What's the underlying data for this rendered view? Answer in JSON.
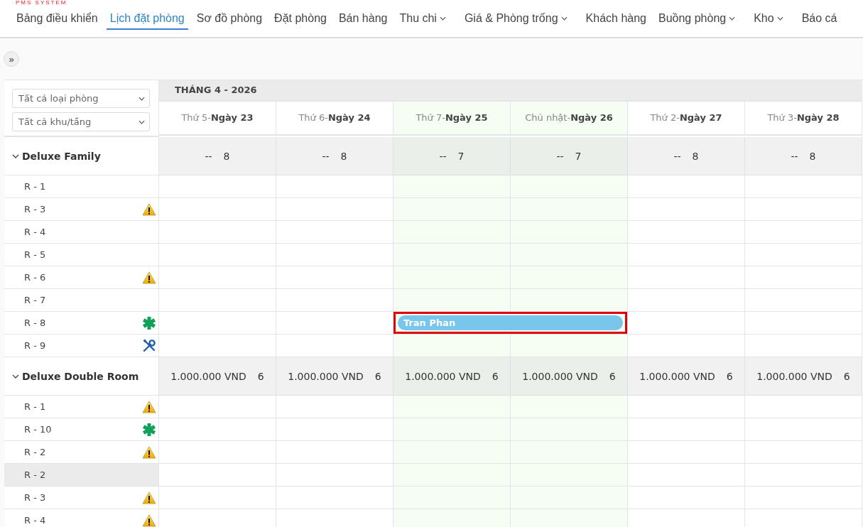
{
  "brand": "PMS SYSTEM",
  "nav": [
    {
      "label": "Bảng điều khiển",
      "selected": false,
      "dropdown": false
    },
    {
      "label": "Lịch đặt phòng",
      "selected": true,
      "dropdown": false
    },
    {
      "label": "Sơ đồ phòng",
      "selected": false,
      "dropdown": false
    },
    {
      "label": "Đặt phòng",
      "selected": false,
      "dropdown": false
    },
    {
      "label": "Bán hàng",
      "selected": false,
      "dropdown": false
    },
    {
      "label": "Thu chi",
      "selected": false,
      "dropdown": true
    },
    {
      "label": "Giá & Phòng trống",
      "selected": false,
      "dropdown": true
    },
    {
      "label": "Khách hàng",
      "selected": false,
      "dropdown": false
    },
    {
      "label": "Buồng phòng",
      "selected": false,
      "dropdown": true
    },
    {
      "label": "Kho",
      "selected": false,
      "dropdown": true
    },
    {
      "label": "Báo cá",
      "selected": false,
      "dropdown": false
    }
  ],
  "expand_button": "»",
  "filters": [
    {
      "value": "Tất cả loại phòng"
    },
    {
      "value": "Tất cả khu/tầng"
    }
  ],
  "month": "THÁNG 4 - 2026",
  "days": [
    {
      "weekday": "Thứ 5-",
      "day": "Ngày 23",
      "weekend": false
    },
    {
      "weekday": "Thứ 6-",
      "day": "Ngày 24",
      "weekend": false
    },
    {
      "weekday": "Thứ 7-",
      "day": "Ngày 25",
      "weekend": true
    },
    {
      "weekday": "Chủ nhật-",
      "day": "Ngày 26",
      "weekend": true
    },
    {
      "weekday": "Thứ 2-",
      "day": "Ngày 27",
      "weekend": false
    },
    {
      "weekday": "Thứ 3-",
      "day": "Ngày 28",
      "weekend": false
    }
  ],
  "groups": [
    {
      "name": "Deluxe Family",
      "expanded": true,
      "cells": [
        {
          "price": "--",
          "count": "8"
        },
        {
          "price": "--",
          "count": "8"
        },
        {
          "price": "--",
          "count": "7"
        },
        {
          "price": "--",
          "count": "7"
        },
        {
          "price": "--",
          "count": "8"
        },
        {
          "price": "--",
          "count": "8"
        }
      ],
      "rooms": [
        {
          "name": "R - 1",
          "kind": "plain",
          "selected": false
        },
        {
          "name": "R - 3",
          "kind": "warning",
          "selected": false
        },
        {
          "name": "R - 4",
          "kind": "plain",
          "selected": false
        },
        {
          "name": "R - 5",
          "kind": "plain",
          "selected": false
        },
        {
          "name": "R - 6",
          "kind": "warning",
          "selected": false
        },
        {
          "name": "R - 7",
          "kind": "plain",
          "selected": false
        },
        {
          "name": "R - 8",
          "kind": "asterisk",
          "selected": false,
          "booking": {
            "guest": "Tran Phan",
            "selected": true,
            "days": [
              false,
              false,
              true,
              true,
              false,
              false
            ]
          }
        },
        {
          "name": "R - 9",
          "kind": "tools",
          "selected": false
        }
      ]
    },
    {
      "name": "Deluxe Double Room",
      "expanded": true,
      "cells": [
        {
          "price": "1.000.000 VND",
          "count": "6"
        },
        {
          "price": "1.000.000 VND",
          "count": "6"
        },
        {
          "price": "1.000.000 VND",
          "count": "6"
        },
        {
          "price": "1.000.000 VND",
          "count": "6"
        },
        {
          "price": "1.000.000 VND",
          "count": "6"
        },
        {
          "price": "1.000.000 VND",
          "count": "6"
        }
      ],
      "rooms": [
        {
          "name": "R - 1",
          "kind": "warning",
          "selected": false
        },
        {
          "name": "R - 10",
          "kind": "asterisk",
          "selected": false
        },
        {
          "name": "R - 2",
          "kind": "warning",
          "selected": false
        },
        {
          "name": "R - 2",
          "kind": "plain",
          "selected": true
        },
        {
          "name": "R - 3",
          "kind": "warning",
          "selected": false
        },
        {
          "name": "R - 4",
          "kind": "warning",
          "selected": false
        }
      ]
    }
  ]
}
